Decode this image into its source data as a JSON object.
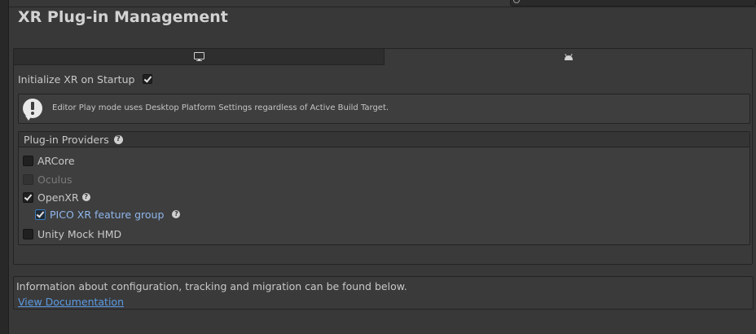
{
  "page": {
    "title": "XR Plug-in Management"
  },
  "tabs": [
    {
      "name": "desktop",
      "icon": "monitor-icon",
      "selected": false
    },
    {
      "name": "android",
      "icon": "android-icon",
      "selected": true
    }
  ],
  "settings": {
    "init_xr_label": "Initialize XR on Startup",
    "init_xr_checked": true
  },
  "help": {
    "icon": "exclamation-icon",
    "text": "Editor Play mode uses Desktop Platform Settings regardless of Active Build Target."
  },
  "providers": {
    "title": "Plug-in Providers",
    "help_icon": "question-icon",
    "items": [
      {
        "label": "ARCore",
        "checked": false,
        "enabled": true
      },
      {
        "label": "Oculus",
        "checked": false,
        "enabled": false
      },
      {
        "label": "OpenXR",
        "checked": true,
        "enabled": true
      },
      {
        "label": "PICO XR feature group",
        "checked": true,
        "enabled": true
      },
      {
        "label": "Unity Mock HMD",
        "checked": false,
        "enabled": true
      }
    ]
  },
  "info": {
    "text": "Information about configuration, tracking and migration can be found below.",
    "link_label": "View Documentation"
  },
  "colors": {
    "background": "#383838",
    "link": "#5b9be4",
    "feature_group_text": "#8eb6ec"
  }
}
